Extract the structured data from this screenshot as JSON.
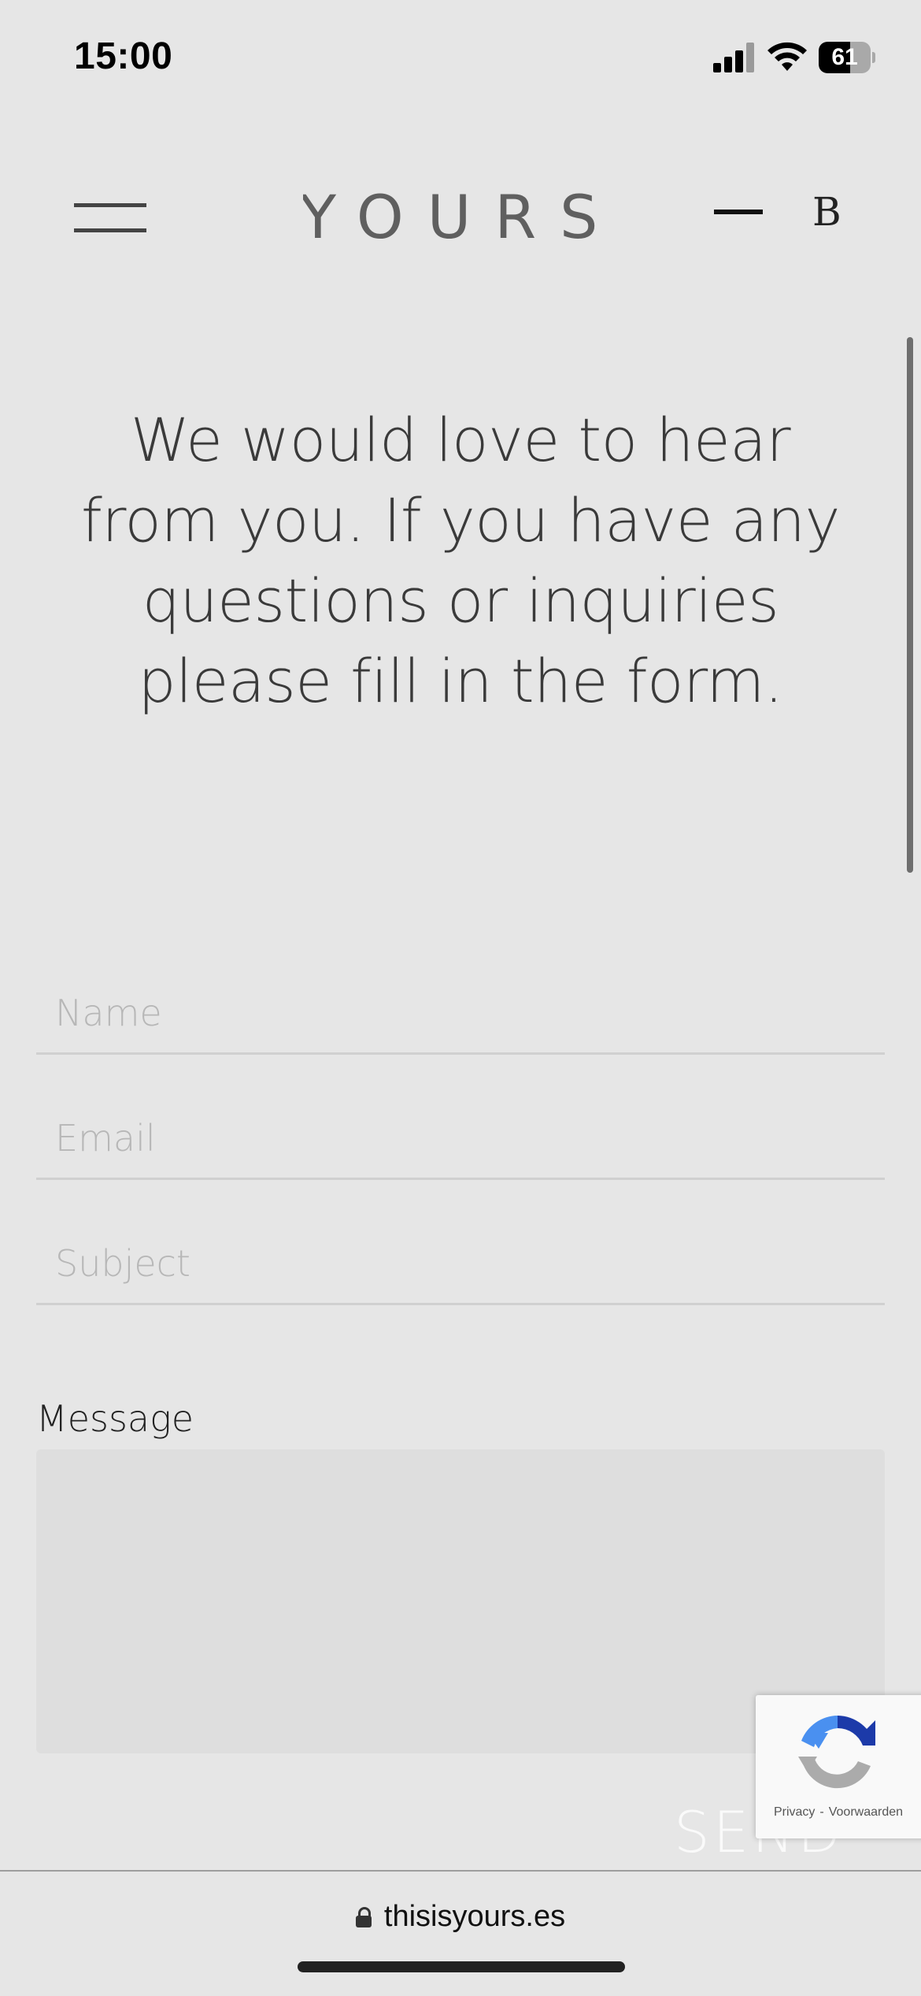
{
  "status_bar": {
    "time": "15:00",
    "battery_level": "61",
    "battery_fraction": 0.61,
    "signal_bars_active": 3,
    "signal_bars_total": 4
  },
  "header": {
    "logo_text": "YOURS",
    "language_label": "B",
    "icons": [
      "menu-icon",
      "language-dash"
    ]
  },
  "hero": {
    "text": "We would love to hear from you. If you have any questions or inquiries please fill in the form."
  },
  "form": {
    "name_placeholder": "Name",
    "email_placeholder": "Email",
    "subject_placeholder": "Subject",
    "message_label": "Message",
    "message_value": "",
    "send_label": "SEND"
  },
  "recaptcha": {
    "privacy_label": "Privacy",
    "separator": "-",
    "terms_label": "Voorwaarden"
  },
  "url_bar": {
    "domain": "thisisyours.es",
    "icon": "lock-icon"
  },
  "colors": {
    "background": "#e6e6e6",
    "text_dark": "#333333",
    "placeholder": "#b7b7b7",
    "recaptcha_blue": "#4a74e8"
  }
}
